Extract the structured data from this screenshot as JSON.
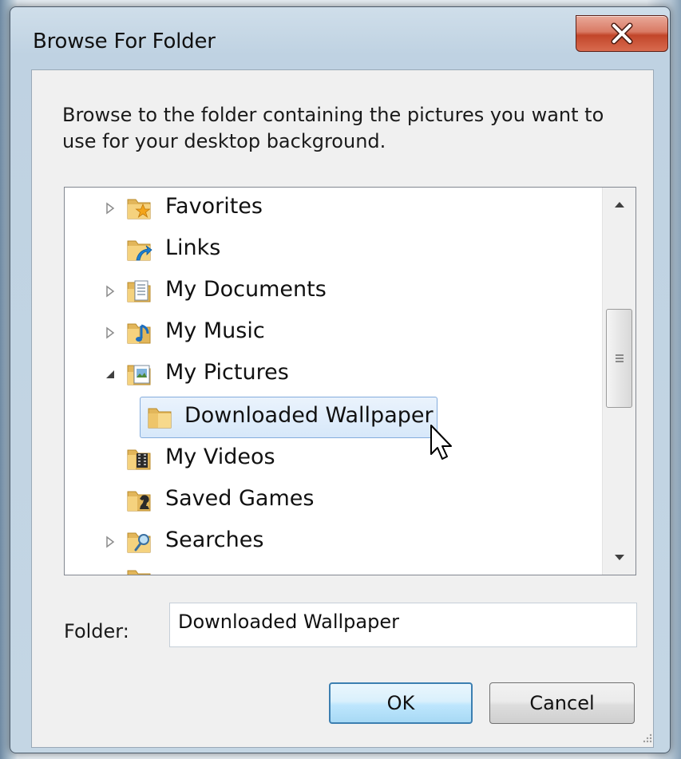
{
  "window": {
    "title": "Browse For Folder",
    "close_glyph": "X"
  },
  "instructions": "Browse to the folder containing the pictures you want to use for your desktop background.",
  "tree": {
    "items": [
      {
        "label": "Favorites",
        "expander": "collapsed",
        "icon": "favorites-folder-icon",
        "depth": 0
      },
      {
        "label": "Links",
        "expander": "none",
        "icon": "links-folder-icon",
        "depth": 0
      },
      {
        "label": "My Documents",
        "expander": "collapsed",
        "icon": "documents-folder-icon",
        "depth": 0
      },
      {
        "label": "My Music",
        "expander": "collapsed",
        "icon": "music-folder-icon",
        "depth": 0
      },
      {
        "label": "My Pictures",
        "expander": "expanded",
        "icon": "pictures-folder-icon",
        "depth": 0
      },
      {
        "label": "Downloaded Wallpaper",
        "expander": "none",
        "icon": "folder-icon",
        "depth": 1,
        "selected": true
      },
      {
        "label": "My Videos",
        "expander": "none",
        "icon": "videos-folder-icon",
        "depth": 0
      },
      {
        "label": "Saved Games",
        "expander": "none",
        "icon": "saved-games-folder-icon",
        "depth": 0
      },
      {
        "label": "Searches",
        "expander": "collapsed",
        "icon": "searches-folder-icon",
        "depth": 0
      }
    ],
    "selected_index": 5
  },
  "folder_field": {
    "label": "Folder:",
    "value": "Downloaded Wallpaper"
  },
  "buttons": {
    "ok": "OK",
    "cancel": "Cancel"
  },
  "colors": {
    "selection_border": "#84acdd",
    "selection_fill": "#d7e8fa",
    "close_button": "#c2462a",
    "default_button_border": "#3c7fb1"
  }
}
